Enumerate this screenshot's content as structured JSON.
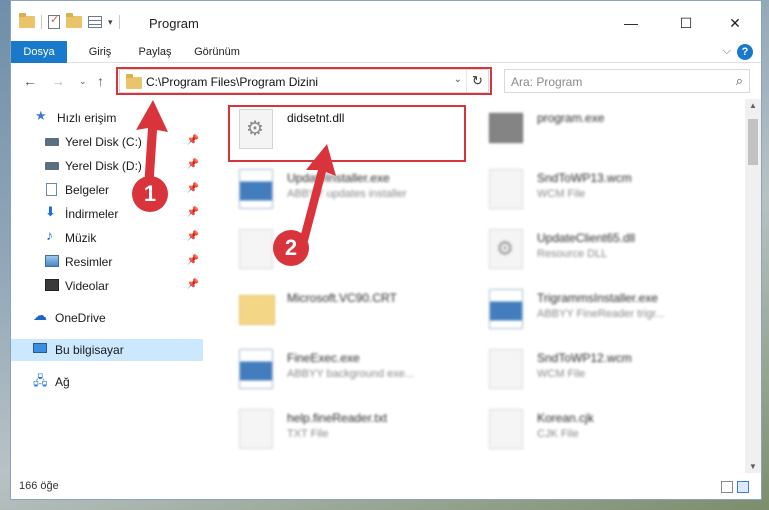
{
  "window": {
    "title": "Program",
    "controls": {
      "minimize": "—",
      "maximize": "☐",
      "close": "✕"
    }
  },
  "ribbon": {
    "tabs": [
      "Dosya",
      "Giriş",
      "Paylaş",
      "Görünüm"
    ]
  },
  "address": {
    "path": "C:\\Program Files\\Program Dizini",
    "search_placeholder": "Ara: Program"
  },
  "nav": {
    "items": [
      {
        "label": "Hızlı erişim",
        "icon": "star-icon"
      },
      {
        "label": "Yerel Disk (C:)",
        "icon": "drive-icon",
        "pinned": true
      },
      {
        "label": "Yerel Disk (D:)",
        "icon": "drive-icon",
        "pinned": true
      },
      {
        "label": "Belgeler",
        "icon": "documents-icon",
        "pinned": true
      },
      {
        "label": "İndirmeler",
        "icon": "downloads-icon",
        "pinned": true
      },
      {
        "label": "Müzik",
        "icon": "music-icon",
        "pinned": true
      },
      {
        "label": "Resimler",
        "icon": "pictures-icon",
        "pinned": true
      },
      {
        "label": "Videolar",
        "icon": "videos-icon",
        "pinned": true
      },
      {
        "label": "OneDrive",
        "icon": "cloud-icon"
      },
      {
        "label": "Bu bilgisayar",
        "icon": "computer-icon",
        "selected": true
      },
      {
        "label": "Ağ",
        "icon": "network-icon"
      }
    ]
  },
  "files": [
    {
      "name": "didsetnt.dll",
      "type": "",
      "icon": "dll-file-icon",
      "highlighted": true
    },
    {
      "name": "program.exe",
      "type": "",
      "icon": "app-icon"
    },
    {
      "name": "UpdateInstaller.exe",
      "type": "ABBYY updates installer",
      "icon": "exe-icon"
    },
    {
      "name": "SndToWP13.wcm",
      "type": "WCM File",
      "icon": "file-icon"
    },
    {
      "name": "",
      "type": "",
      "icon": "file-icon"
    },
    {
      "name": "UpdateClient65.dll",
      "type": "Resource DLL",
      "icon": "dll-file-icon"
    },
    {
      "name": "Microsoft.VC90.CRT",
      "type": "",
      "icon": "folder-icon"
    },
    {
      "name": "TrigrammsInstaller.exe",
      "type": "ABBYY FineReader trigr...",
      "icon": "exe-icon"
    },
    {
      "name": "FineExec.exe",
      "type": "ABBYY background exe...",
      "icon": "exe-icon"
    },
    {
      "name": "SndToWP12.wcm",
      "type": "WCM File",
      "icon": "file-icon"
    },
    {
      "name": "help.fineReader.txt",
      "type": "TXT File",
      "icon": "file-icon"
    },
    {
      "name": "Korean.cjk",
      "type": "CJK File",
      "icon": "file-icon"
    }
  ],
  "status": {
    "count": "166 öğe"
  },
  "annotations": {
    "step1": "1",
    "step2": "2",
    "color": "#d9333b"
  },
  "colors": {
    "accent": "#1979ca",
    "selection": "#cce8ff"
  }
}
